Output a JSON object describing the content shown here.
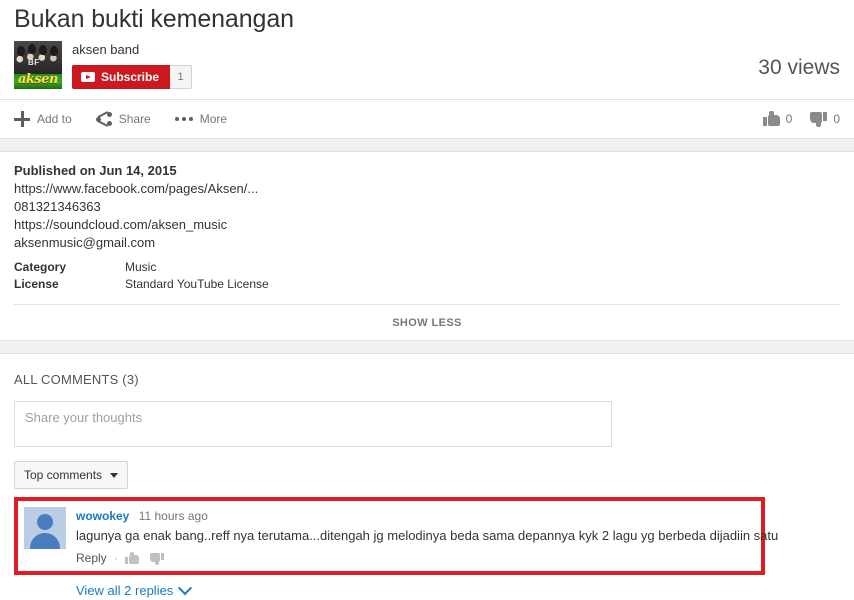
{
  "video": {
    "title": "Bukan bukti kemenangan",
    "channel_name": "aksen band",
    "subscribe_label": "Subscribe",
    "subscriber_count": "1",
    "views": "30 views",
    "thumbnail_word": "aksen",
    "thumbnail_sub": "BF"
  },
  "actions": {
    "add_to": "Add to",
    "share": "Share",
    "more": "More",
    "likes": "0",
    "dislikes": "0"
  },
  "description": {
    "published": "Published on Jun 14, 2015",
    "lines": [
      "https://www.facebook.com/pages/Aksen/...",
      "081321346363",
      "https://soundcloud.com/aksen_music",
      "aksenmusic@gmail.com"
    ],
    "meta": [
      {
        "key": "Category",
        "value": "Music"
      },
      {
        "key": "License",
        "value": "Standard YouTube License"
      }
    ],
    "show_less": "SHOW LESS"
  },
  "comments": {
    "heading": "ALL COMMENTS (3)",
    "input_placeholder": "Share your thoughts",
    "sort_label": "Top comments",
    "items": [
      {
        "author": "wowokey",
        "time": "11 hours ago",
        "text": "lagunya ga enak bang..reff nya terutama...ditengah jg melodinya beda sama depannya kyk 2 lagu yg berbeda dijadiin satu",
        "reply_label": "Reply",
        "separator": "·",
        "highlighted": true
      }
    ],
    "view_replies": "View all 2 replies"
  },
  "colors": {
    "subscribe_red": "#cc181e",
    "highlight_red": "#e01b21",
    "link_blue": "#167ac6"
  }
}
